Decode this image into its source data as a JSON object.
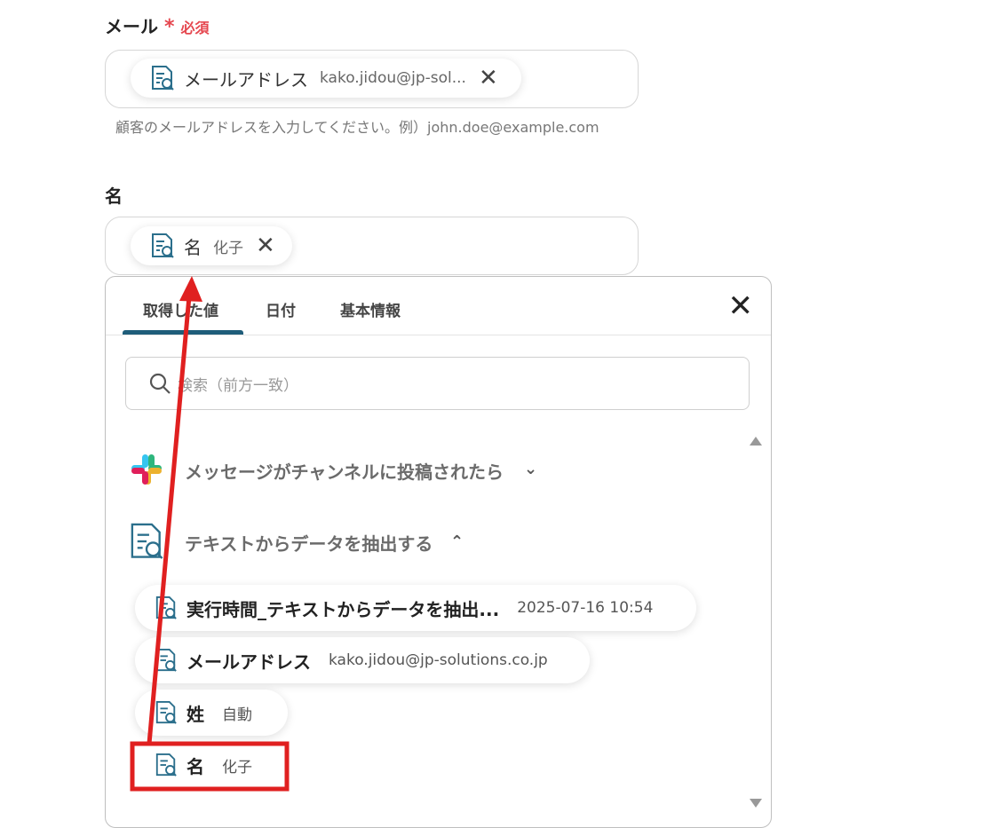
{
  "email_field": {
    "label": "メール",
    "required_mark": "*",
    "required_text": "必須",
    "chip": {
      "name": "メールアドレス",
      "value": "kako.jidou@jp-sol..."
    },
    "hint": "顧客のメールアドレスを入力してください。例）john.doe@example.com"
  },
  "name_field": {
    "label": "名",
    "chip": {
      "name": "名",
      "value": "化子"
    }
  },
  "panel": {
    "tabs": [
      {
        "label": "取得した値"
      },
      {
        "label": "日付"
      },
      {
        "label": "基本情報"
      }
    ],
    "search_placeholder": "検索（前方一致）",
    "groups": [
      {
        "title": "メッセージがチャンネルに投稿されたら",
        "icon": "slack-icon",
        "expanded": false
      },
      {
        "title": "テキストからデータを抽出する",
        "icon": "document-search-icon",
        "expanded": true
      }
    ],
    "items": [
      {
        "name": "実行時間_テキストからデータを抽出...",
        "value": "2025-07-16 10:54"
      },
      {
        "name": "メールアドレス",
        "value": "kako.jidou@jp-solutions.co.jp"
      },
      {
        "name": "姓",
        "value": "自動"
      },
      {
        "name": "名",
        "value": "化子"
      }
    ]
  },
  "colors": {
    "accent": "#1f5d7a",
    "required": "#e5474f",
    "annotation": "#e02020"
  }
}
